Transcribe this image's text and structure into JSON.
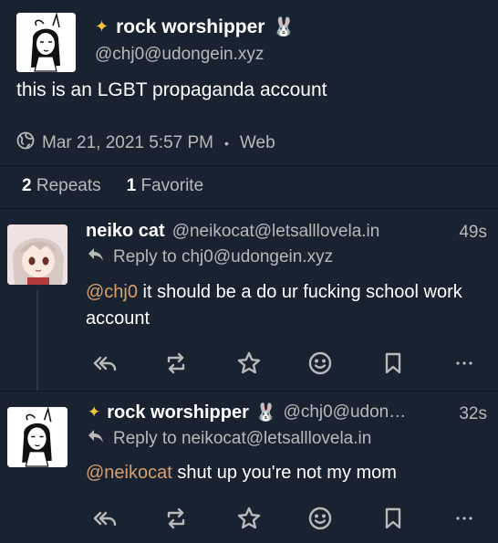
{
  "main_post": {
    "display_name": "rock worshipper",
    "handle": "@chj0@udongein.xyz",
    "text": "this is an LGBT propaganda account",
    "date": "Mar 21, 2021 5:57 PM",
    "separator": "•",
    "client": "Web",
    "repeats_count": "2",
    "repeats_label": "Repeats",
    "favorites_count": "1",
    "favorites_label": "Favorite"
  },
  "replies": [
    {
      "display_name": "neiko cat",
      "handle": "@neikocat@letsalllovela.in",
      "time": "49s",
      "reply_to": "Reply to chj0@udongein.xyz",
      "mention": "@chj0",
      "text": " it should be a do ur fucking school work account"
    },
    {
      "display_name": "rock worshipper",
      "handle": "@chj0@udon…",
      "time": "32s",
      "reply_to": "Reply to neikocat@letsalllovela.in",
      "mention": "@neikocat",
      "text": " shut up you're not my mom"
    }
  ],
  "icons": {
    "sparkle": "sparkles-icon",
    "rabbit": "rabbit-face-icon",
    "globe": "globe-icon",
    "reply": "reply-arrow-icon",
    "reply_all": "reply-all-icon",
    "repeat": "repeat-icon",
    "favorite": "star-icon",
    "react": "smiley-icon",
    "bookmark": "bookmark-icon",
    "more": "more-dots-icon"
  },
  "colors": {
    "background": "#182230",
    "text": "#ffffff",
    "muted": "#b9b9ba",
    "mention": "#d8a070",
    "sparkle": "#f5c33b"
  }
}
